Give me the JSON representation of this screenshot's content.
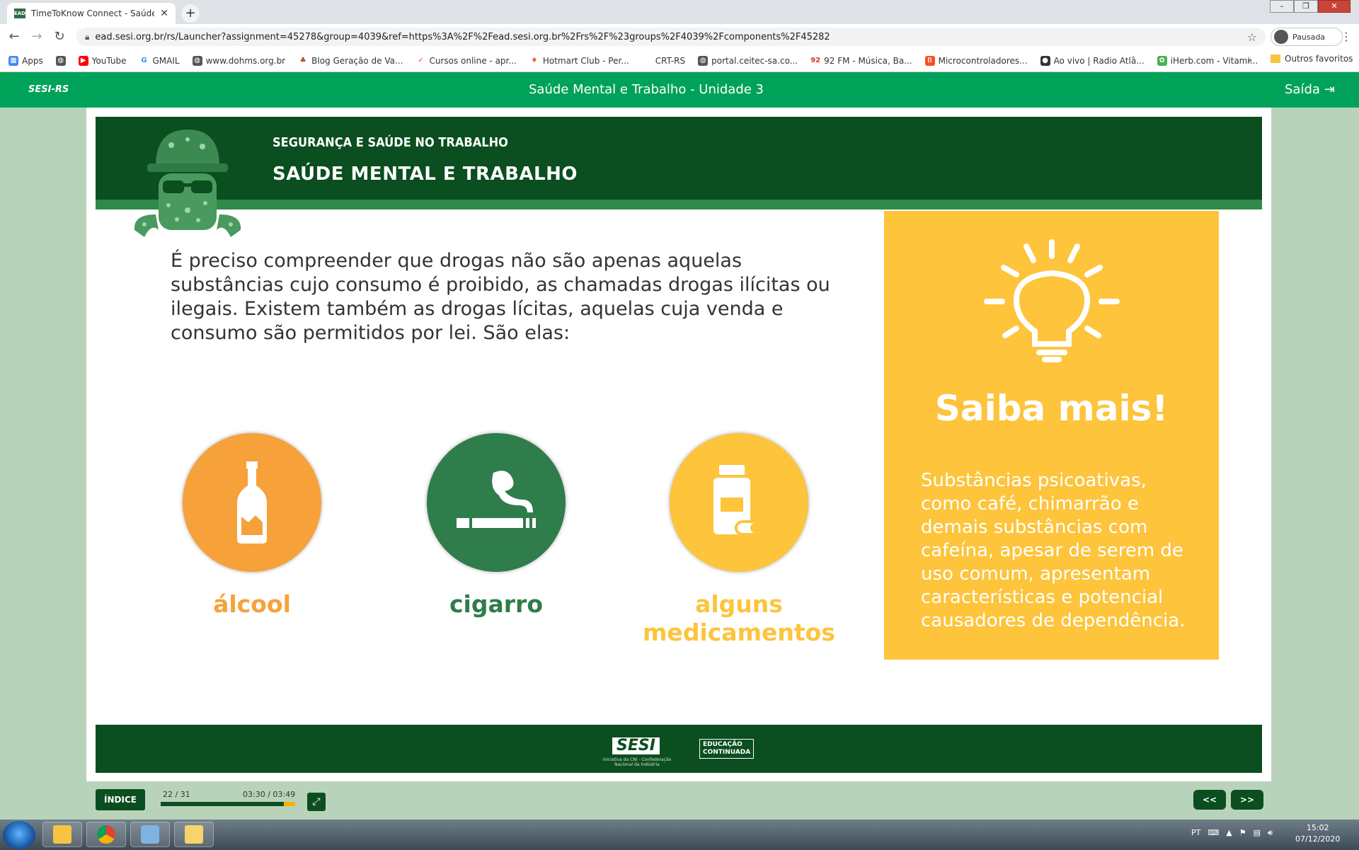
{
  "browser": {
    "tab_title": "TimeToKnow Connect - Saúde M",
    "tab_favicon_text": "EAD",
    "url": "ead.sesi.org.br/rs/Launcher?assignment=45278&group=4039&ref=https%3A%2F%2Fead.sesi.org.br%2Frs%2F%23groups%2F4039%2Fcomponents%2F45282",
    "profile_label": "Pausada",
    "bookmarks": [
      {
        "label": "Apps",
        "color": "#4285f4"
      },
      {
        "label": "",
        "color": "#555555"
      },
      {
        "label": "YouTube",
        "color": "#ff0000"
      },
      {
        "label": "GMAIL",
        "color": "#4285f4"
      },
      {
        "label": "www.dohms.org.br",
        "color": "#555555"
      },
      {
        "label": "Blog Geração de Va...",
        "color": "#c0392b"
      },
      {
        "label": "Cursos online - apr...",
        "color": "#e74c3c"
      },
      {
        "label": "Hotmart Club - Per...",
        "color": "#f05a28"
      },
      {
        "label": "CRT-RS",
        "color": "#ffffff"
      },
      {
        "label": "portal.ceitec-sa.co...",
        "color": "#555555"
      },
      {
        "label": "92 FM - Música, Ba...",
        "color": "#d32f2f"
      },
      {
        "label": "Microcontroladores...",
        "color": "#f4511e"
      },
      {
        "label": "Ao vivo | Radio Atlâ...",
        "color": "#333333"
      },
      {
        "label": "iHerb.com - Vitami...",
        "color": "#4caf50"
      }
    ],
    "bookmarks_more": "»",
    "other_bookmarks": "Outros favoritos"
  },
  "app": {
    "logo": "SESI-RS",
    "title": "Saúde Mental e Trabalho - Unidade 3",
    "exit_label": "Saída"
  },
  "banner": {
    "kicker": "SEGURANÇA E SAÚDE NO TRABALHO",
    "heading": "SAÚDE MENTAL E TRABALHO"
  },
  "intro_text": "É preciso compreender que drogas não são apenas aquelas substâncias cujo consumo é proibido, as chamadas drogas ilícitas ou ilegais. Existem também as drogas lícitas, aquelas cuja venda e consumo são permitidos por lei. São elas:",
  "drugs": [
    {
      "label": "álcool",
      "icon": "bottle-icon",
      "color": "#f7a13a"
    },
    {
      "label": "cigarro",
      "icon": "cigarette-icon",
      "color": "#2e7d4a"
    },
    {
      "label": "alguns medicamentos",
      "icon": "medicine-icon",
      "color": "#fdc43c"
    }
  ],
  "saiba_mais": {
    "heading": "Saiba mais!",
    "body": "Substâncias psicoativas, como café, chimarrão e demais substâncias com cafeína, apesar de serem de uso comum, apresentam características e potencial causadores de dependência.",
    "icon": "lightbulb-icon",
    "color": "#fdc43c"
  },
  "footer": {
    "sesi_logo": "SESI",
    "sesi_sub": "Iniciativa da CNI - Confederação Nacional da Indústria",
    "edu_logo_line1": "EDUCAÇÃO",
    "edu_logo_line2": "CONTINUADA"
  },
  "player": {
    "index_label": "ÍNDICE",
    "page_count": "22 / 31",
    "time": "03:30 / 03:49",
    "progress": 0.917,
    "prev_label": "<<",
    "next_label": ">>"
  },
  "taskbar": {
    "language": "PT",
    "time": "15:02",
    "date": "07/12/2020"
  }
}
